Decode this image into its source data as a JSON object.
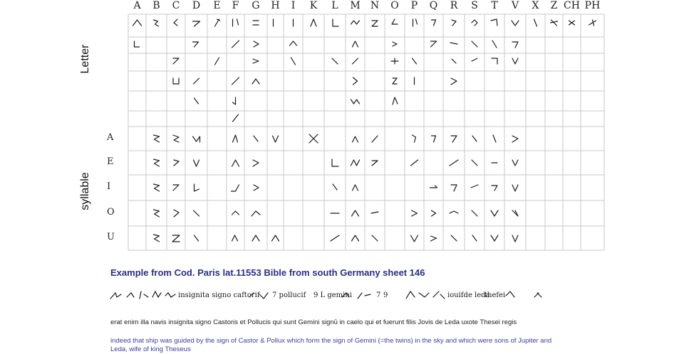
{
  "columns": [
    "A",
    "B",
    "C",
    "D",
    "E",
    "F",
    "G",
    "H",
    "I",
    "K",
    "L",
    "M",
    "N",
    "O",
    "P",
    "Q",
    "R",
    "S",
    "T",
    "V",
    "X",
    "Z",
    "CH",
    "PH"
  ],
  "row_groups": {
    "letter_label": "Letter",
    "syllable_label": "syllable"
  },
  "syllable_rows": [
    "A",
    "E",
    "I",
    "O",
    "U"
  ],
  "example": {
    "caption": "Example from Cod. Paris lat.11553 Bible from south Germany sheet 146",
    "latin": "erat enim illa navis  insignita signo  Castoris et Pollucis qui sunt Gemini signū in  caelo qui et fuerunt filis Jovis de Leda uxote Thesei regis",
    "english": "indeed that ship was guided by the sign of Castor & Pollux which form the sign of Gemini (=the twins) in the sky and which were sons of Jupiter and Leda, wife of king Theseus"
  },
  "colors": {
    "grid": "#c8c8c8",
    "ink": "#1a1a1a",
    "caption": "#2b2f86",
    "english": "#3a3fa0"
  }
}
